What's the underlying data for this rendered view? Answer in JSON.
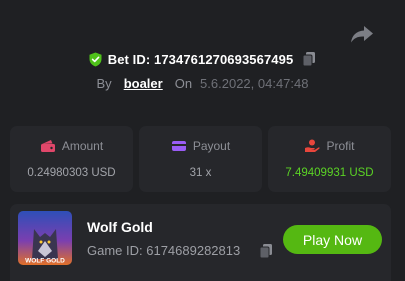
{
  "header": {
    "bet_id": "Bet ID: 1734761270693567495",
    "by_label": "By",
    "username": "boaler",
    "on_label": "On",
    "date": "5.6.2022, 04:47:48"
  },
  "stats": [
    {
      "label": "Amount",
      "value": "0.24980303 USD",
      "icon": "wallet-icon"
    },
    {
      "label": "Payout",
      "value": "31 x",
      "icon": "card-icon"
    },
    {
      "label": "Profit",
      "value": "7.49409931 USD",
      "icon": "hand-coin-icon"
    }
  ],
  "game": {
    "title": "Wolf Gold",
    "game_id": "Game ID: 6174689282813",
    "thumbnail_text": "WOLF GOLD",
    "play_label": "Play Now"
  },
  "colors": {
    "background": "#1f2023",
    "card": "#26272b",
    "verified_green": "#4fc21a",
    "profit_green": "#5bd325",
    "play_button": "#55b812",
    "amount_icon": "#e0476a",
    "payout_icon": "#9a5cf5",
    "profit_icon": "#e8463c"
  }
}
